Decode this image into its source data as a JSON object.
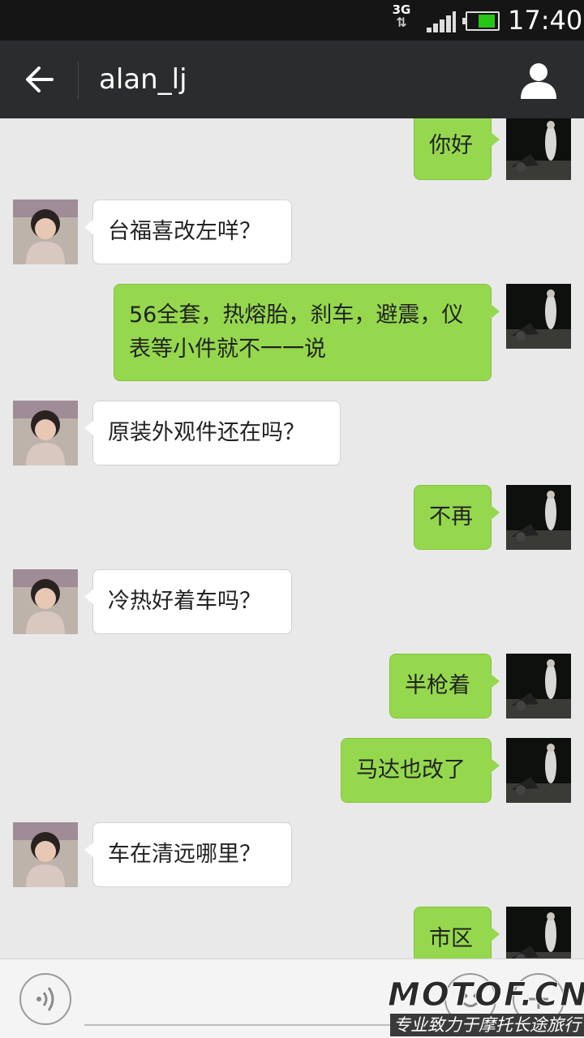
{
  "status_bar": {
    "network": "3G",
    "time": "17:40"
  },
  "header": {
    "title": "alan_lj"
  },
  "messages": [
    {
      "side": "out",
      "text": "你好"
    },
    {
      "side": "in",
      "text": "台福喜改左咩？"
    },
    {
      "side": "out",
      "text": "56全套，热熔胎，刹车，避震，仪表等小件就不一一说"
    },
    {
      "side": "in",
      "text": "原装外观件还在吗？"
    },
    {
      "side": "out",
      "text": "不再"
    },
    {
      "side": "in",
      "text": "冷热好着车吗？"
    },
    {
      "side": "out",
      "text": "半枪着"
    },
    {
      "side": "out",
      "text": "马达也改了"
    },
    {
      "side": "in",
      "text": "车在清远哪里？"
    },
    {
      "side": "out",
      "text": "市区"
    }
  ],
  "input_bar": {
    "placeholder": ""
  },
  "watermark": {
    "logo": "MOTOF.CN",
    "tagline": "专业致力于摩托长途旅行"
  },
  "colors": {
    "outgoing_bubble": "#95d84e",
    "incoming_bubble": "#ffffff",
    "background": "#e9e9e9",
    "header": "#2a2c2e"
  }
}
